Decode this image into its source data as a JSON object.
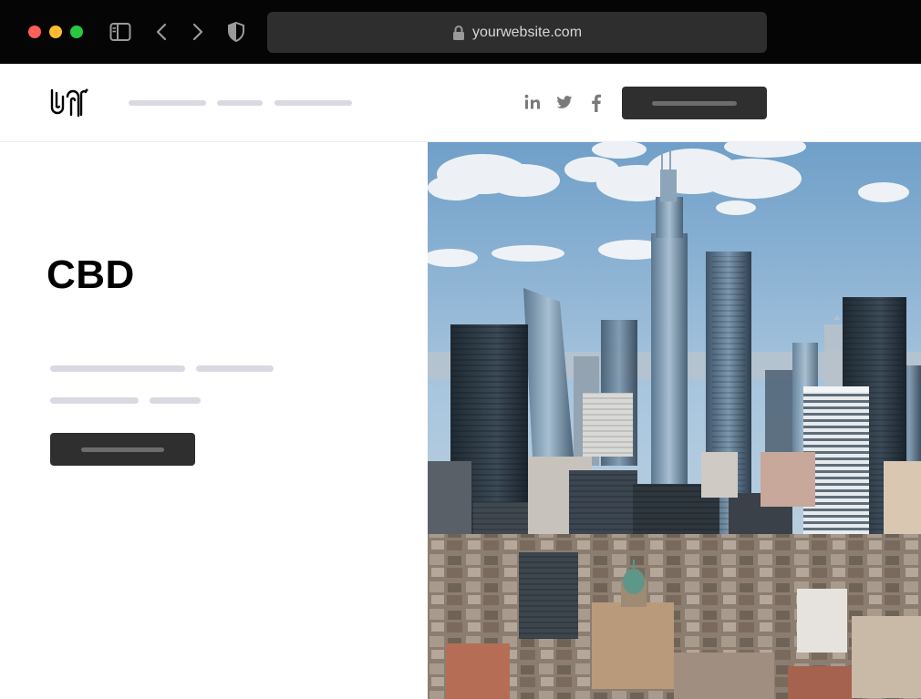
{
  "browser": {
    "url": "yourwebsite.com",
    "traffic_lights": {
      "close": "#fe5f57",
      "minimize": "#febc2e",
      "maximize": "#28c840"
    },
    "chrome_bg": "#050505",
    "icons": [
      "sidebar-icon",
      "back-arrow-icon",
      "forward-arrow-icon",
      "shield-icon",
      "lock-icon"
    ]
  },
  "header": {
    "logo_icon": "logo-icon",
    "social_icons": [
      "linkedin-icon",
      "twitter-icon",
      "facebook-icon"
    ],
    "cta_color": "#2f2f2f"
  },
  "hero": {
    "title": "CBD",
    "button_color": "#2f2f2f",
    "image_icon": "city-skyline-photo"
  }
}
